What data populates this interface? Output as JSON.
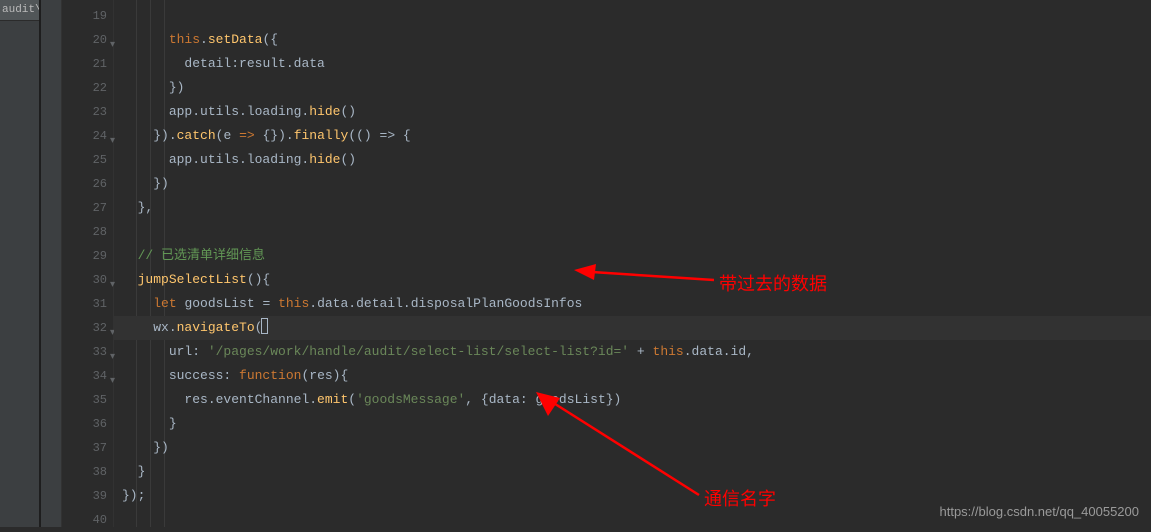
{
  "tab": {
    "label": "audit\\..."
  },
  "gutter": {
    "start": 19,
    "end": 40,
    "folds": [
      20,
      24,
      30,
      32,
      33,
      34
    ]
  },
  "code": {
    "l19": {
      "pre": "        "
    },
    "l20": {
      "indent": "      ",
      "this": "this",
      "dot": ".",
      "method": "setData",
      "open": "({"
    },
    "l21": {
      "indent": "        ",
      "key": "detail",
      "colon": ":",
      "val": "result.data"
    },
    "l22": {
      "indent": "      ",
      "close": "})"
    },
    "l23": {
      "indent": "      ",
      "seg1": "app.utils.loading.",
      "method": "hide",
      "call": "()"
    },
    "l24": {
      "indent": "    ",
      "close1": "}).",
      "catch": "catch",
      "paren1": "(",
      "e": "e",
      "arrow": " => ",
      "empty": "{}",
      "close2": ").",
      "finally": "finally",
      "arg": "(() => {"
    },
    "l25": {
      "indent": "      ",
      "seg1": "app.utils.loading.",
      "method": "hide",
      "call": "()"
    },
    "l26": {
      "indent": "    ",
      "close": "})"
    },
    "l27": {
      "indent": "  ",
      "close": "},"
    },
    "l28": {
      "indent": ""
    },
    "l29": {
      "indent": "  ",
      "comment": "// 已选清单详细信息"
    },
    "l30": {
      "indent": "  ",
      "method": "jumpSelectList",
      "call": "(){"
    },
    "l31": {
      "indent": "    ",
      "let": "let",
      "sp": " ",
      "var": "goodsList",
      "eq": " = ",
      "this": "this",
      "rest": ".data.detail.disposalPlanGoodsInfos"
    },
    "l32": {
      "indent": "    ",
      "obj": "wx.",
      "method": "navigateTo",
      "open": "(",
      "brace": "{"
    },
    "l33": {
      "indent": "      ",
      "key": "url",
      "colon": ": ",
      "str": "'/pages/work/handle/audit/select-list/select-list?id='",
      "plus": " + ",
      "this": "this",
      "rest": ".data.id,"
    },
    "l34": {
      "indent": "      ",
      "key": "success",
      "colon": ": ",
      "fn": "function",
      "open": "(",
      "param": "res",
      "close": "){"
    },
    "l35": {
      "indent": "        ",
      "seg1": "res.eventChannel.",
      "method": "emit",
      "open": "(",
      "str": "'goodsMessage'",
      "comma": ", {",
      "key": "data",
      "colon": ": ",
      "var": "goodsList",
      "close": "})"
    },
    "l36": {
      "indent": "      ",
      "close": "}"
    },
    "l37": {
      "indent": "    ",
      "close": "})"
    },
    "l38": {
      "indent": "  ",
      "close": "}"
    },
    "l39": {
      "indent": "",
      "close": "});"
    },
    "l40": {
      "indent": ""
    }
  },
  "annotations": {
    "a1": "带过去的数据",
    "a2": "通信名字"
  },
  "watermark": "https://blog.csdn.net/qq_40055200"
}
